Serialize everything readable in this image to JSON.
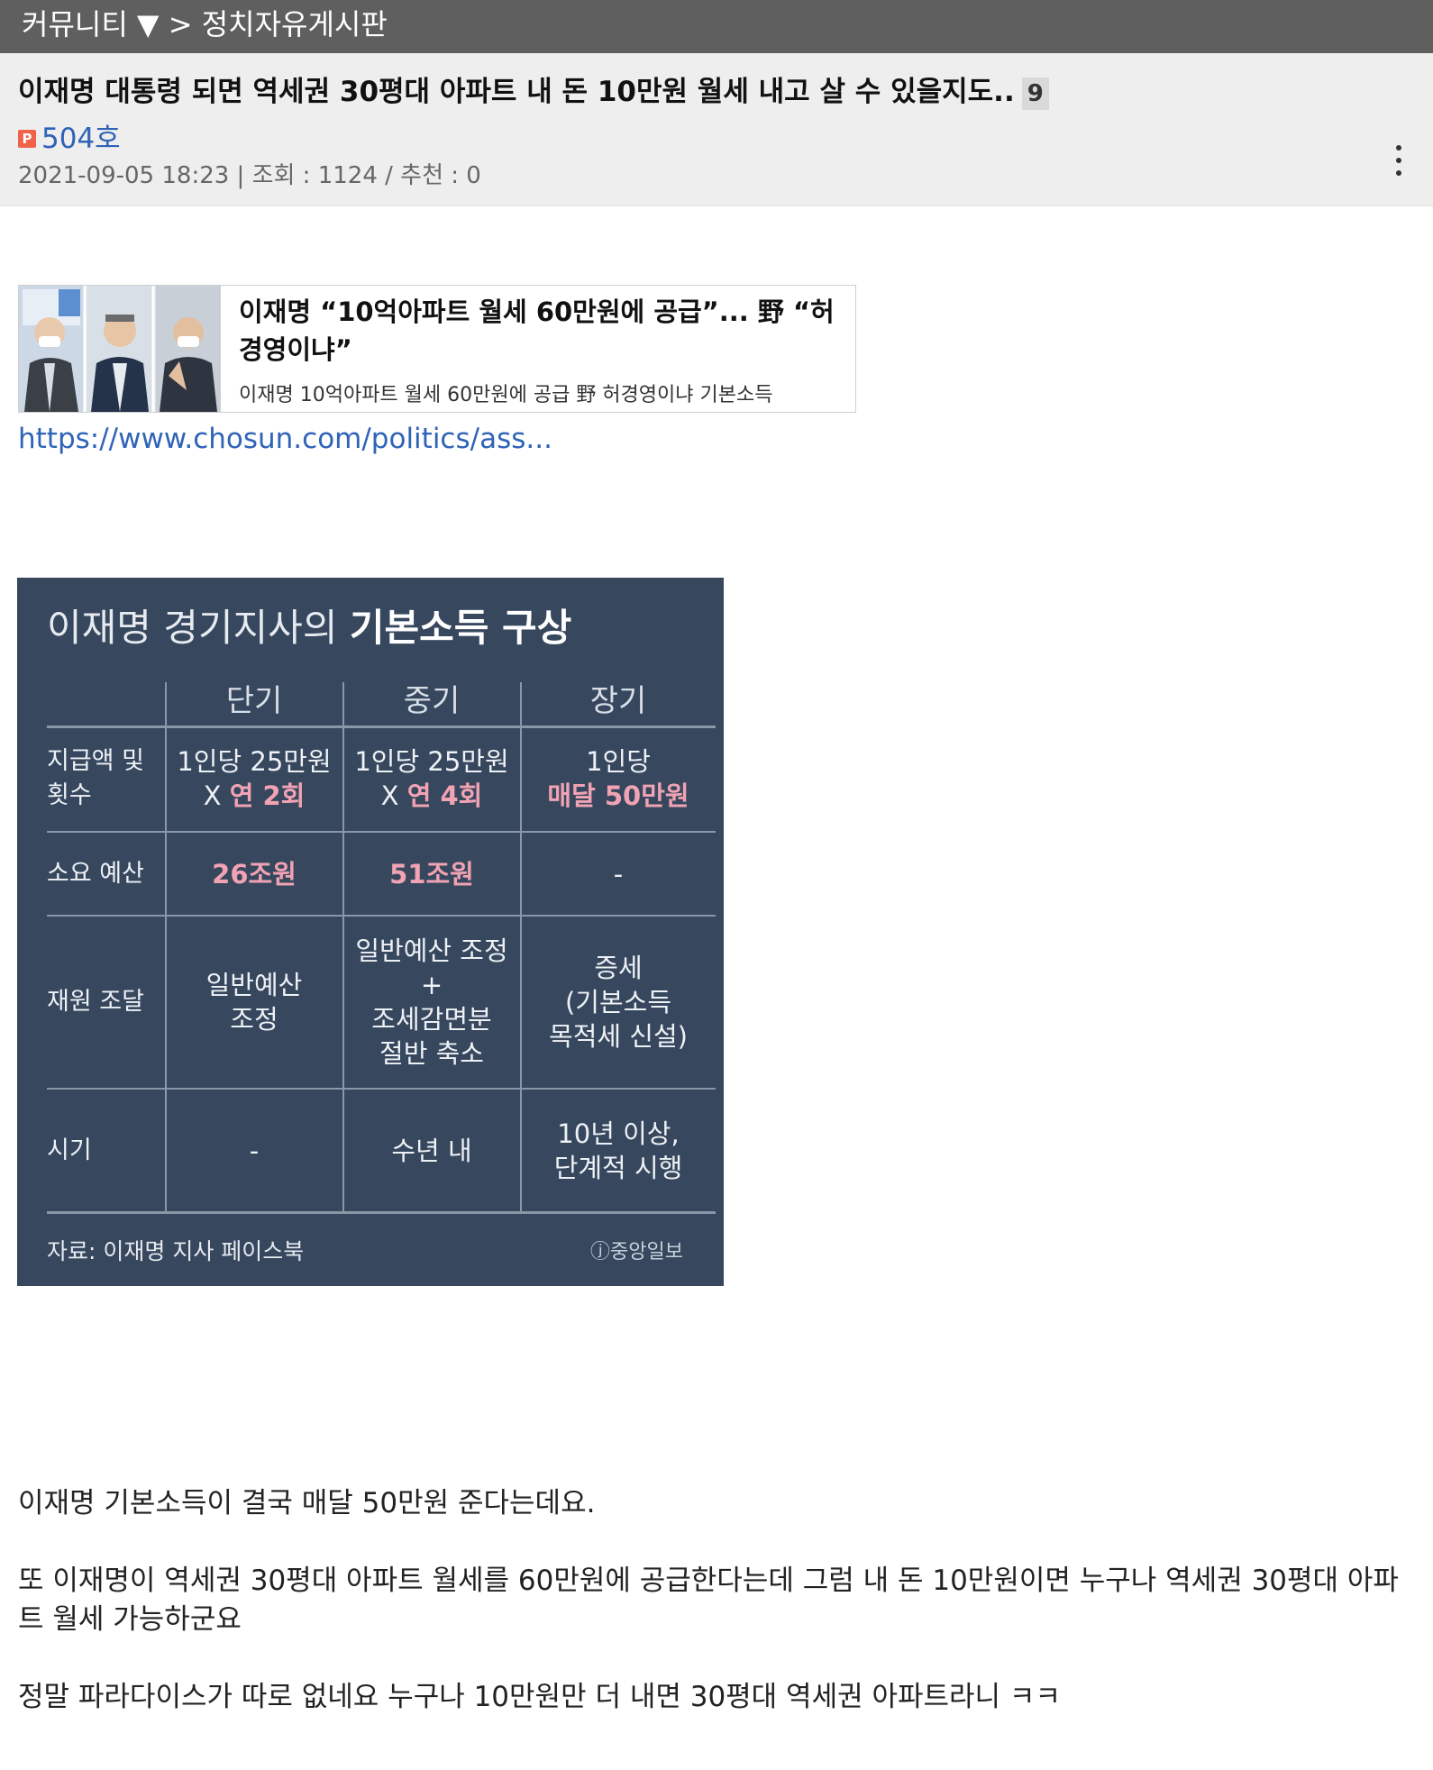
{
  "topbar": {
    "community": "커뮤니티 ▼",
    "separator": " > ",
    "board": "정치자유게시판"
  },
  "post": {
    "title": "이재명 대통령 되면 역세권 30평대 아파트 내 돈 10만원 월세 내고 살 수 있을지도..",
    "comment_count": "9",
    "author_icon": "P",
    "author": "504호",
    "meta": "2021-09-05 18:23 | 조회 : 1124 / 추천 : 0"
  },
  "link_card": {
    "title": "이재명 “10억아파트 월세 60만원에 공급”... 野 “허경영이냐”",
    "description": "이재명 10억아파트 월세 60만원에 공급 野 허경영이냐 기본소득",
    "url": "https://www.chosun.com/politics/ass..."
  },
  "infographic": {
    "title_light": "이재명 경기지사의 ",
    "title_bold": "기본소득 구상",
    "columns": [
      "단기",
      "중기",
      "장기"
    ],
    "rows": [
      {
        "label": "지급액 및\n횟수",
        "cells": [
          {
            "plain": "1인당 25만원\nX ",
            "highlight": "연 2회"
          },
          {
            "plain": "1인당 25만원\nX ",
            "highlight": "연 4회"
          },
          {
            "plain": "1인당\n",
            "highlight": "매달 50만원"
          }
        ]
      },
      {
        "label": "소요 예산",
        "cells": [
          {
            "plain": "",
            "highlight": "26조원"
          },
          {
            "plain": "",
            "highlight": "51조원"
          },
          {
            "plain": "-",
            "highlight": ""
          }
        ]
      },
      {
        "label": "재원 조달",
        "cells": [
          {
            "plain": "일반예산\n조정",
            "highlight": ""
          },
          {
            "plain": "일반예산 조정\n+\n조세감면분\n절반 축소",
            "highlight": ""
          },
          {
            "plain": "증세\n(기본소득\n목적세 신설)",
            "highlight": ""
          }
        ]
      },
      {
        "label": "시기",
        "cells": [
          {
            "plain": "-",
            "highlight": ""
          },
          {
            "plain": "수년 내",
            "highlight": ""
          },
          {
            "plain": "10년 이상,\n단계적 시행",
            "highlight": ""
          }
        ]
      }
    ],
    "source": "자료: 이재명 지사 페이스북",
    "logo": "ⓙ중앙일보"
  },
  "body": [
    "이재명 기본소득이 결국 매달 50만원 준다는데요.",
    "또 이재명이 역세권 30평대 아파트 월세를 60만원에 공급한다는데 그럼 내 돈 10만원이면 누구나 역세권 30평대 아파트 월세 가능하군요",
    "정말 파라다이스가 따로 없네요 누구나 10만원만 더 내면 30평대 역세권 아파트라니 ㅋㅋ"
  ],
  "colors": {
    "topbar": "#5f5f5f",
    "header": "#eeeeee",
    "link": "#2f63b8",
    "infographic_bg": "#36475e",
    "highlight": "#f2a3b3"
  }
}
